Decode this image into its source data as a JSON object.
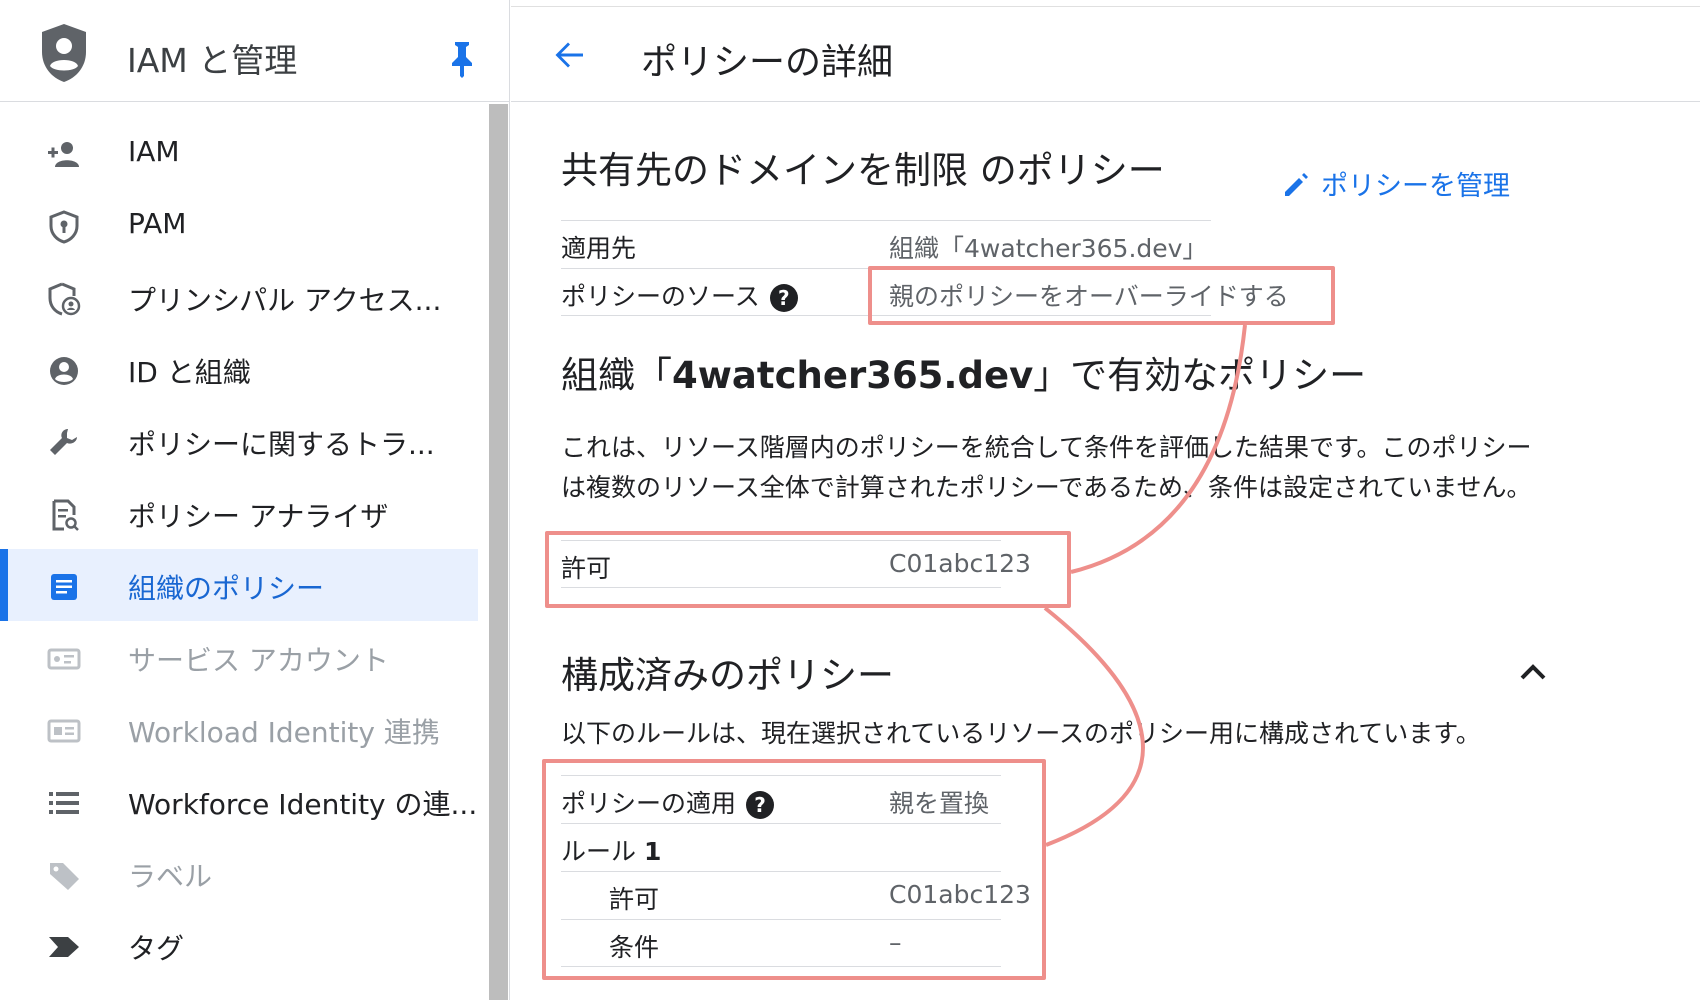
{
  "sidebar": {
    "title": "IAM と管理",
    "items": [
      {
        "label": "IAM",
        "icon": "person-add-icon",
        "state": "normal"
      },
      {
        "label": "PAM",
        "icon": "shield-icon",
        "state": "normal"
      },
      {
        "label": "プリンシパル アクセス...",
        "icon": "shield-user-icon",
        "state": "normal"
      },
      {
        "label": "ID と組織",
        "icon": "account-circle-icon",
        "state": "normal"
      },
      {
        "label": "ポリシーに関するトラ...",
        "icon": "wrench-icon",
        "state": "normal"
      },
      {
        "label": "ポリシー アナライザ",
        "icon": "document-search-icon",
        "state": "normal"
      },
      {
        "label": "組織のポリシー",
        "icon": "list-box-icon",
        "state": "active"
      },
      {
        "label": "サービス アカウント",
        "icon": "service-account-icon",
        "state": "disabled"
      },
      {
        "label": "Workload Identity 連携",
        "icon": "id-card-icon",
        "state": "disabled"
      },
      {
        "label": "Workforce Identity の連...",
        "icon": "list-icon",
        "state": "normal"
      },
      {
        "label": "ラベル",
        "icon": "label-icon",
        "state": "disabled"
      },
      {
        "label": "タグ",
        "icon": "tag-arrow-icon",
        "state": "normal"
      }
    ]
  },
  "header": {
    "title": "ポリシーの詳細"
  },
  "policy": {
    "heading": "共有先のドメインを制限 のポリシー",
    "manage_label": "ポリシーを管理",
    "rows": [
      {
        "key": "適用先",
        "value": "組織「4watcher365.dev」"
      },
      {
        "key": "ポリシーのソース",
        "value": "親のポリシーをオーバーライドする"
      }
    ]
  },
  "effective": {
    "heading_prefix": "組織「",
    "heading_org": "4watcher365.dev",
    "heading_suffix": "」で有効なポリシー",
    "desc_line1": "これは、リソース階層内のポリシーを統合して条件を評価した結果です。このポリシー",
    "desc_line2": "は複数のリソース全体で計算されたポリシーであるため、条件は設定されていません。",
    "row_key": "許可",
    "row_value": "C01abc123"
  },
  "configured": {
    "heading": "構成済みのポリシー",
    "desc": "以下のルールは、現在選択されているリソースのポリシー用に構成されています。",
    "enforcement_key": "ポリシーの適用",
    "enforcement_value": "親を置換",
    "rule_label": "ルール ",
    "rule_number": "1",
    "allow_key": "許可",
    "allow_value": "C01abc123",
    "condition_key": "条件",
    "condition_value": "–"
  },
  "colors": {
    "accent": "#1a73e8",
    "highlight": "#ee8f8b",
    "active_bg": "#e8f0fe"
  }
}
